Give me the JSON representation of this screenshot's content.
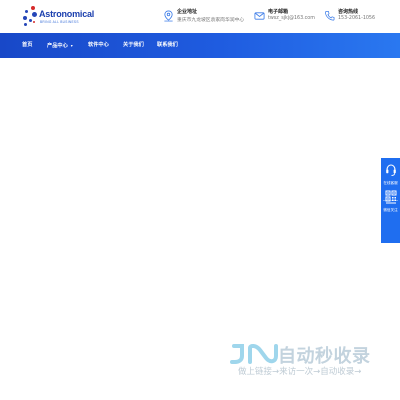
{
  "brand": {
    "logo_text": "Astronomical",
    "logo_subtext": "BRING ALL BUSINESS"
  },
  "contacts": [
    {
      "icon": "location-pin-icon",
      "title": "企业地址",
      "value": "重庆市九龙坡区袁家岗华润中心"
    },
    {
      "icon": "mail-icon",
      "title": "电子邮箱",
      "value": "twsz_sjkj@163.com"
    },
    {
      "icon": "phone-icon",
      "title": "咨询热线",
      "value": "153-2061-1056"
    }
  ],
  "nav": {
    "items": [
      {
        "label": "首页"
      },
      {
        "label": "产品中心",
        "has_dropdown": true
      },
      {
        "label": "软件中心"
      },
      {
        "label": "关于我们"
      },
      {
        "label": "联系我们"
      }
    ]
  },
  "side_panel": {
    "service_label": "在线客服",
    "wechat_label": "微信关注"
  },
  "watermark": {
    "title": "自动秒收录",
    "subtitle": "做上链接→来访一次→自动收录→"
  },
  "colors": {
    "nav_start": "#1848c8",
    "nav_end": "#2a78f0",
    "side_panel": "#1f6ef0",
    "logo_blue": "#1b3fae"
  }
}
